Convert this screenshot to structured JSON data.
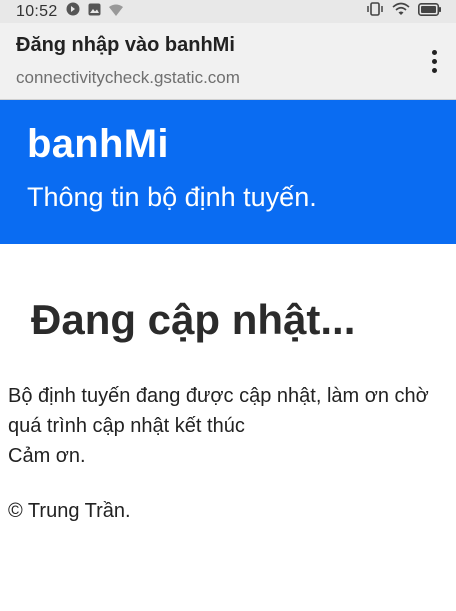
{
  "status_bar": {
    "time": "10:52",
    "icons": [
      "vpn-key-icon",
      "image-icon",
      "wifi-off-icon",
      "vibrate-icon",
      "wifi-icon",
      "battery-icon"
    ]
  },
  "app_bar": {
    "title": "Đăng nhập vào banhMi",
    "url": "connectivitycheck.gstatic.com",
    "menu_icon": "more-vert-icon"
  },
  "hero": {
    "title": "banhMi",
    "subtitle": "Thông tin bộ định tuyến.",
    "color": "#0a6cf2"
  },
  "main": {
    "heading": "Đang cập nhật...",
    "message_line1": "Bộ định tuyến đang được cập nhật, làm ơn chờ quá trình cập nhật kết thúc",
    "message_line2": "Cảm ơn.",
    "copyright": "© Trung Trần."
  }
}
